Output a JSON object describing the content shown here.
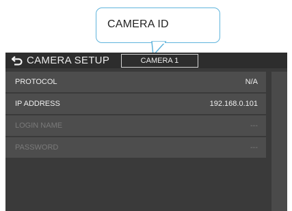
{
  "callout": {
    "text": "CAMERA ID"
  },
  "header": {
    "title": "CAMERA SETUP",
    "camera_id": "CAMERA 1"
  },
  "rows": [
    {
      "label": "PROTOCOL",
      "value": "N/A",
      "enabled": true
    },
    {
      "label": "IP ADDRESS",
      "value": "192.168.0.101",
      "enabled": true
    },
    {
      "label": "LOGIN NAME",
      "value": "---",
      "enabled": false
    },
    {
      "label": "PASSWORD",
      "value": "---",
      "enabled": false
    }
  ],
  "icons": {
    "back": "back-arrow-icon"
  },
  "colors": {
    "callout_border": "#5fb4dc",
    "panel_bg": "#3a3a3a",
    "header_bg": "#2d2d2d",
    "row_bg": "#4d4d4d",
    "text": "#f0f0f0",
    "text_disabled": "#7a7a7a"
  }
}
